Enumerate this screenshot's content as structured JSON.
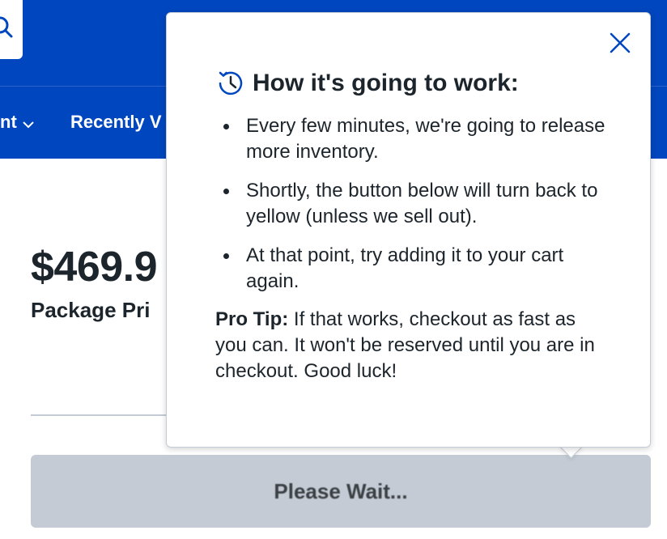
{
  "header": {
    "nav": [
      {
        "label": "nt"
      },
      {
        "label": "Recently V"
      }
    ]
  },
  "product": {
    "price": "$469.9",
    "price_label": "Package Pri"
  },
  "button": {
    "label": "Please Wait...",
    "state": "disabled"
  },
  "popover": {
    "title": "How it's going to work:",
    "bullets": [
      "Every few minutes, we're going to release more inventory.",
      "Shortly, the button below will turn back to yellow (unless we sell out).",
      "At that point, try adding it to your cart again."
    ],
    "pro_tip_label": "Pro Tip:",
    "pro_tip_text": " If that works, checkout as fast as you can. It won't be reserved until you are in checkout. Good luck!"
  },
  "colors": {
    "header_blue": "#0046be",
    "button_gray": "#c5cbd5",
    "text_dark": "#1d252c",
    "icon_blue": "#0046be"
  }
}
